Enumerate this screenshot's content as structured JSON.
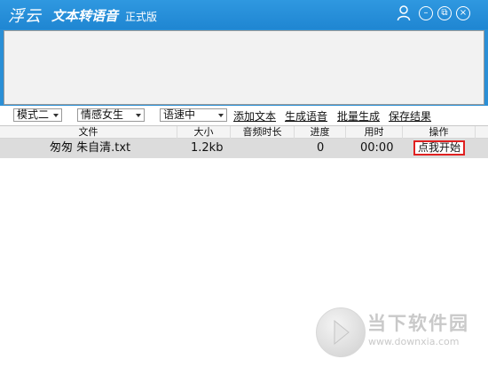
{
  "titlebar": {
    "logo": "浮云",
    "app_name": "文本转语音",
    "edition": "正式版",
    "buttons": {
      "minimize": "–",
      "restore": "⧉",
      "close": "×"
    }
  },
  "toolbar": {
    "mode_select": "模式二",
    "voice_select": "情感女生",
    "speed_select": "语速中",
    "links": [
      "添加文本",
      "生成语音",
      "批量生成",
      "保存结果"
    ]
  },
  "table": {
    "headers": [
      "文件",
      "大小",
      "音频时长",
      "进度",
      "用时",
      "操作"
    ],
    "rows": [
      {
        "file": "匆匆  朱自清.txt",
        "size": "1.2kb",
        "duration": "",
        "progress": "0",
        "time": "00:00",
        "action": "点我开始"
      }
    ]
  },
  "watermark": {
    "brand": "当下软件园",
    "url": "www.downxia.com"
  },
  "colors": {
    "titlebar": "#2a8fd6",
    "action_border": "#e02020"
  }
}
